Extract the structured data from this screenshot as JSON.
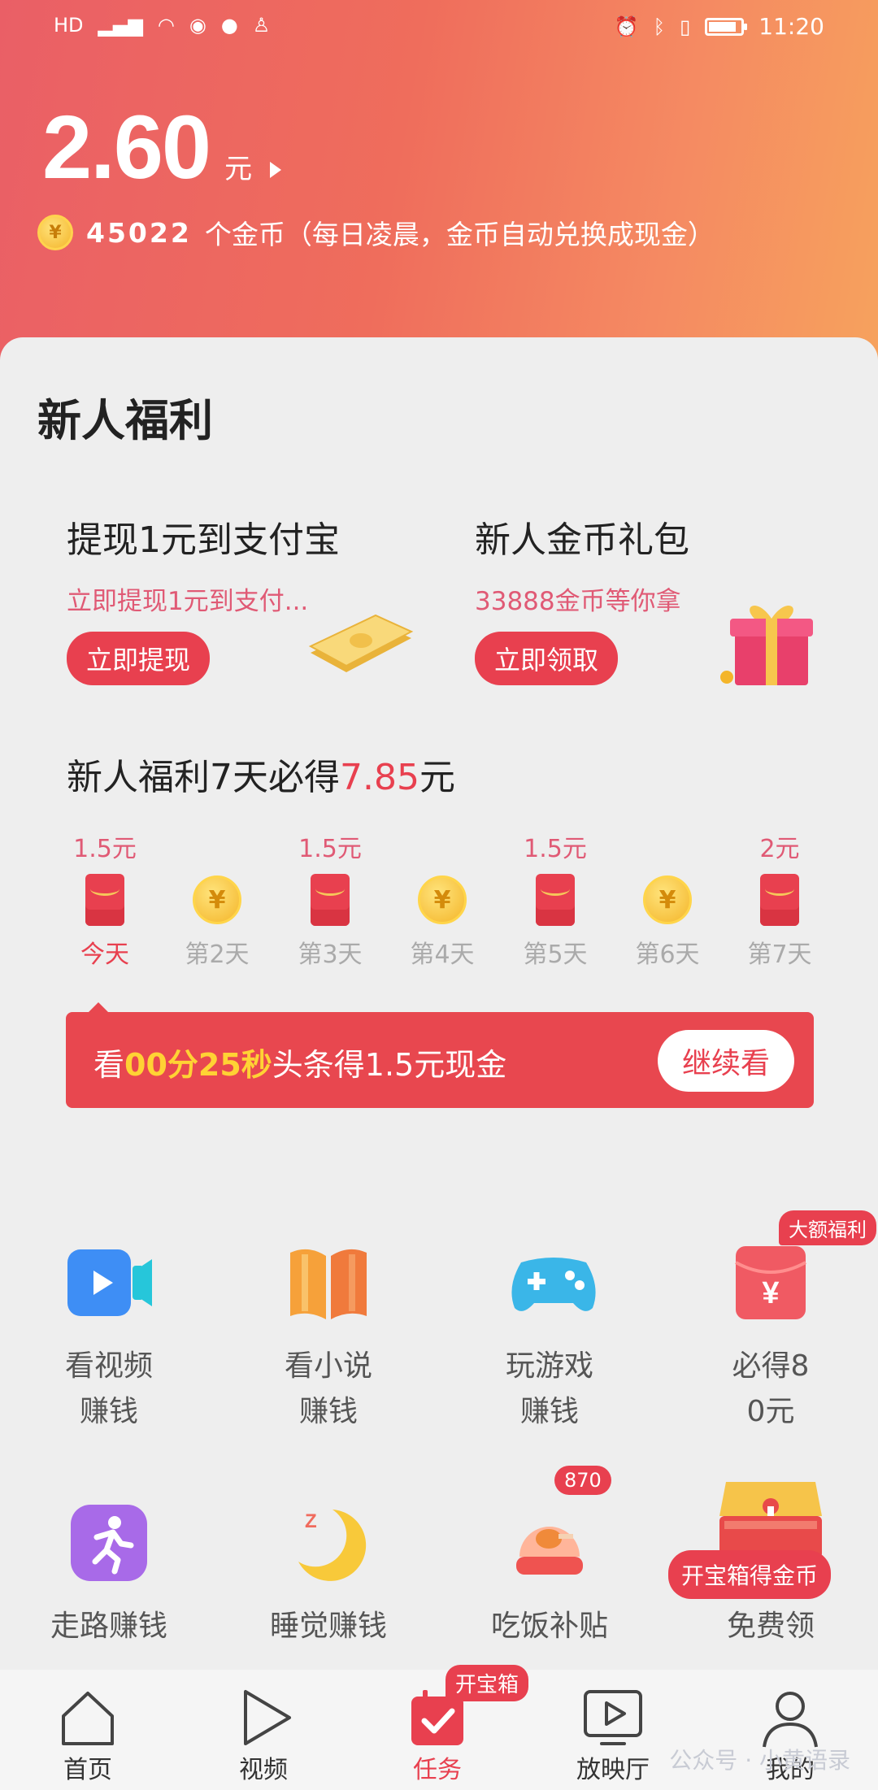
{
  "status_bar": {
    "left_icons": [
      "hd-icon",
      "5g-signal-icon",
      "wifi-icon",
      "eye-icon",
      "wechat-icon",
      "qq-icon"
    ],
    "right_icons": [
      "alarm-icon",
      "bluetooth-icon",
      "vibrate-icon"
    ],
    "battery_level": 0.85,
    "time": "11:20"
  },
  "header": {
    "balance": "2.60",
    "unit": "元",
    "coins": "45022",
    "coin_text": "个金币（每日凌晨，金币自动兑换成现金）"
  },
  "newbie": {
    "title": "新人福利",
    "offers": [
      {
        "title": "提现1元到支付宝",
        "subtitle": "立即提现1元到支付...",
        "button": "立即提现"
      },
      {
        "title": "新人金币礼包",
        "subtitle": "33888金币等你拿",
        "button": "立即领取"
      }
    ],
    "weekly_title_prefix": "新人福利7天必得",
    "weekly_amount": "7.85",
    "weekly_unit": "元",
    "days": [
      {
        "amount": "1.5元",
        "type": "redpack",
        "label": "今天"
      },
      {
        "amount": "",
        "type": "coin",
        "label": "第2天"
      },
      {
        "amount": "1.5元",
        "type": "redpack",
        "label": "第3天"
      },
      {
        "amount": "",
        "type": "coin",
        "label": "第4天"
      },
      {
        "amount": "1.5元",
        "type": "redpack",
        "label": "第5天"
      },
      {
        "amount": "",
        "type": "coin",
        "label": "第6天"
      },
      {
        "amount": "2元",
        "type": "redpack",
        "label": "第7天"
      }
    ],
    "progress": {
      "prefix": "看",
      "time": "00分25秒",
      "suffix": "头条得1.5元现金",
      "button": "继续看"
    }
  },
  "tasks": [
    {
      "label_line1": "看视频",
      "label_line2": "赚钱",
      "icon": "video-camera-icon"
    },
    {
      "label_line1": "看小说",
      "label_line2": "赚钱",
      "icon": "book-icon"
    },
    {
      "label_line1": "玩游戏",
      "label_line2": "赚钱",
      "icon": "gamepad-icon"
    },
    {
      "label_line1": "必得8",
      "label_line2": "0元",
      "icon": "red-envelope-icon",
      "badge": "大额福利"
    },
    {
      "label_line1": "走路赚钱",
      "icon": "running-icon"
    },
    {
      "label_line1": "睡觉赚钱",
      "icon": "moon-icon"
    },
    {
      "label_line1": "吃饭补贴",
      "icon": "chicken-leg-icon",
      "badge": "870"
    },
    {
      "label_line1": "免费领",
      "icon": "treasure-chest-icon",
      "badge": "开宝箱得金币"
    }
  ],
  "bottom_nav": [
    {
      "label": "首页",
      "icon": "home-icon"
    },
    {
      "label": "视频",
      "icon": "play-icon"
    },
    {
      "label": "任务",
      "icon": "calendar-check-icon",
      "badge": "开宝箱",
      "active": true
    },
    {
      "label": "放映厅",
      "icon": "tv-play-icon"
    },
    {
      "label": "我的",
      "icon": "user-icon"
    }
  ],
  "watermark": "公众号 · 小黄语录"
}
